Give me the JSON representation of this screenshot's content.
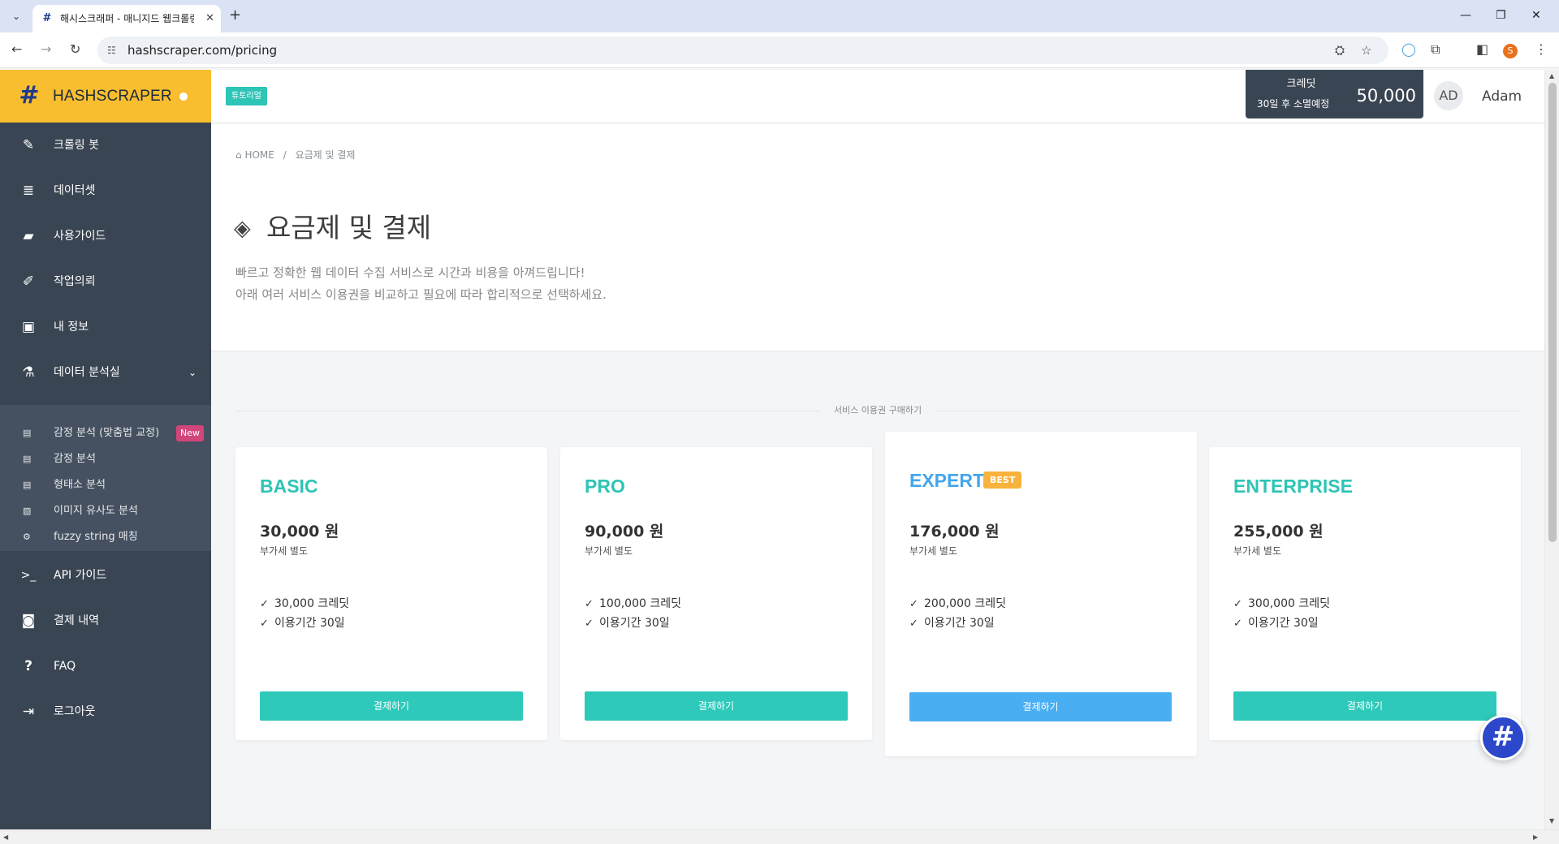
{
  "browser": {
    "tab_title": "해시스크래퍼 - 매니지드 웹크롤링",
    "url": "hashscraper.com/pricing",
    "profile_initial": "S"
  },
  "sidebar": {
    "brand": "HASHSCRAPER",
    "items": [
      {
        "label": "크롤링 봇",
        "icon": "magic-wand-icon",
        "glyph": "✎"
      },
      {
        "label": "데이터셋",
        "icon": "database-icon",
        "glyph": "≣"
      },
      {
        "label": "사용가이드",
        "icon": "book-icon",
        "glyph": "▰"
      },
      {
        "label": "작업의뢰",
        "icon": "edit-icon",
        "glyph": "✐"
      },
      {
        "label": "내 정보",
        "icon": "user-card-icon",
        "glyph": "▣"
      },
      {
        "label": "데이터 분석실",
        "icon": "flask-icon",
        "glyph": "⚗"
      }
    ],
    "submenu": [
      {
        "label": "감정 분석 (맞춤법 교정)",
        "badge": "New",
        "icon": "book-open-icon",
        "glyph": "▤"
      },
      {
        "label": "감정 분석",
        "icon": "book-open-icon",
        "glyph": "▤"
      },
      {
        "label": "형태소 분석",
        "icon": "book-open-icon",
        "glyph": "▤"
      },
      {
        "label": "이미지 유사도 분석",
        "icon": "image-icon",
        "glyph": "▨"
      },
      {
        "label": "fuzzy string 매칭",
        "icon": "cogs-icon",
        "glyph": "⚙"
      }
    ],
    "bottom_items": [
      {
        "label": "API 가이드",
        "icon": "terminal-icon",
        "glyph": ">_"
      },
      {
        "label": "결제 내역",
        "icon": "money-icon",
        "glyph": "◙"
      },
      {
        "label": "FAQ",
        "icon": "question-icon",
        "glyph": "?"
      },
      {
        "label": "로그아웃",
        "icon": "sign-out-icon",
        "glyph": "⇥"
      }
    ]
  },
  "header": {
    "tutorial_label": "튜토리얼",
    "credit_label": "크레딧",
    "credit_expire": "30일 후 소멸예정",
    "credit_amount": "50,000",
    "avatar_initials": "AD",
    "username": "Adam"
  },
  "page": {
    "breadcrumb_home": "HOME",
    "breadcrumb_current": "요금제 및 결제",
    "title": "요금제 및 결제",
    "desc_line1": "빠르고 정확한 웹 데이터 수집 서비스로 시간과 비용을 아껴드립니다!",
    "desc_line2": "아래 여러 서비스 이용권을 비교하고 필요에 따라 합리적으로 선택하세요.",
    "section_label": "서비스 이용권 구매하기"
  },
  "plans": [
    {
      "name": "BASIC",
      "price": "30,000 원",
      "vat": "부가세 별도",
      "credits": "30,000 크레딧",
      "period": "이용기간 30일",
      "button": "결제하기"
    },
    {
      "name": "PRO",
      "price": "90,000 원",
      "vat": "부가세 별도",
      "credits": "100,000 크레딧",
      "period": "이용기간 30일",
      "button": "결제하기"
    },
    {
      "name": "EXPERT",
      "badge": "BEST",
      "price": "176,000 원",
      "vat": "부가세 별도",
      "credits": "200,000 크레딧",
      "period": "이용기간 30일",
      "button": "결제하기"
    },
    {
      "name": "ENTERPRISE",
      "price": "255,000 원",
      "vat": "부가세 별도",
      "credits": "300,000 크레딧",
      "period": "이용기간 30일",
      "button": "결제하기"
    }
  ],
  "colors": {
    "brand_yellow": "#f8be2f",
    "sidebar_bg": "#3a4553",
    "teal_accent": "#2ec4b6",
    "expert_blue": "#4aaef2",
    "best_orange": "#f8b33c",
    "new_badge": "#d2457a"
  }
}
